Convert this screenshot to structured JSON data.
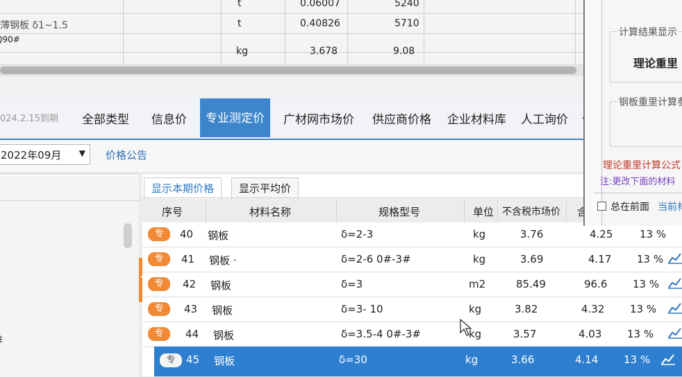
{
  "top_table": {
    "rows": [
      {
        "name": "",
        "unit": "t",
        "value1": "0.06007",
        "value2": "5240"
      },
      {
        "name": "薄钢板 δ1~1.5",
        "unit": "t",
        "value1": "0.40826",
        "value2": "5710"
      },
      {
        "name": "Q90#",
        "unit": "kg",
        "value1": "3.678",
        "value2": "9.08"
      }
    ]
  },
  "tabs": {
    "expire_text": "024.2.15到期",
    "items": [
      "全部类型",
      "信息价",
      "专业测定价",
      "广材网市场价",
      "供应商价格",
      "企业材料库",
      "人工询价",
      "价"
    ],
    "active_index": 2
  },
  "filter": {
    "date_value": "2022年09月",
    "price_notice": "价格公告"
  },
  "left_panel": {
    "fragment": "ŧ"
  },
  "grid": {
    "subtabs": [
      "显示本期价格",
      "显示平均价"
    ],
    "headers": [
      "序号",
      "材料名称",
      "规格型号",
      "单位",
      "不含税市场价",
      "含"
    ],
    "badge_text": "专",
    "rows": [
      {
        "no": "40",
        "name": "钢板",
        "spec": "δ=2-3",
        "unit": "kg",
        "price": "3.76",
        "tax_price": "4.25",
        "rate": "13 %"
      },
      {
        "no": "41",
        "name": "钢板 ·",
        "spec": "δ=2-6 0#-3#",
        "unit": "kg",
        "price": "3.69",
        "tax_price": "4.17",
        "rate": "13 %"
      },
      {
        "no": "42",
        "name": "钢板",
        "spec": "δ=3",
        "unit": "m2",
        "price": "85.49",
        "tax_price": "96.6",
        "rate": "13 %"
      },
      {
        "no": "43",
        "name": "钢板",
        "spec": "δ=3- 10",
        "unit": "kg",
        "price": "3.82",
        "tax_price": "4.32",
        "rate": "13 %"
      },
      {
        "no": "44",
        "name": "钢板",
        "spec": "δ=3.5-4 0#-3#",
        "unit": "kg",
        "price": "3.57",
        "tax_price": "4.03",
        "rate": "13 %"
      },
      {
        "no": "45",
        "name": "钢板",
        "spec": "δ=30",
        "unit": "kg",
        "price": "3.66",
        "tax_price": "4.14",
        "rate": "13 %"
      }
    ],
    "selected_index": 5
  },
  "calc_panel": {
    "result_group_title": "计算结果显示",
    "result_label": "理论重里（",
    "params_group_title": "钢板重里计算参",
    "formula_text": "理论重里计算公式",
    "note_text": "注:更改下面的材料",
    "always_front": "总在前面",
    "current_label": "当前材"
  },
  "colors": {
    "tab_active": "#3d86cc",
    "badge": "#f08a36",
    "selected_row": "#2f7fd0",
    "link": "#2f79c2"
  }
}
